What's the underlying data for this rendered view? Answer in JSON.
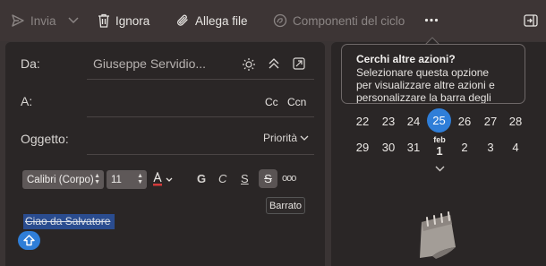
{
  "toolbar": {
    "send_label": "Invia",
    "ignore_label": "Ignora",
    "attach_label": "Allega file",
    "loop_label": "Componenti del ciclo"
  },
  "compose": {
    "from_label": "Da:",
    "from_value": "Giuseppe Servidio...",
    "to_label": "A:",
    "cc_label": "Cc",
    "bcc_label": "Ccn",
    "subject_label": "Oggetto:",
    "priority_label": "Priorità",
    "font_name": "Calibri (Corpo)",
    "font_size": "11",
    "bold_label": "G",
    "italic_label": "C",
    "underline_label": "S",
    "strike_label": "S",
    "more_label": "ooo",
    "strike_tooltip": "Barrato",
    "body_text": "Ciao da Salvatore"
  },
  "calendar": {
    "week1": [
      "22",
      "23",
      "24",
      "25",
      "26",
      "27",
      "28"
    ],
    "week2": [
      "29",
      "30",
      "31",
      "1",
      "2",
      "3",
      "4"
    ],
    "next_month_label": "feb",
    "today": "25"
  },
  "popover": {
    "title": "Cerchi altre azioni?",
    "line1": "Selezionare questa opzione",
    "line2": "per visualizzare altre azioni e",
    "line3": "personalizzare la barra degli"
  },
  "colors": {
    "accent": "#2f7ed8",
    "selection": "#2a4c8f",
    "panel": "#2a2626",
    "background": "#3a3434"
  }
}
